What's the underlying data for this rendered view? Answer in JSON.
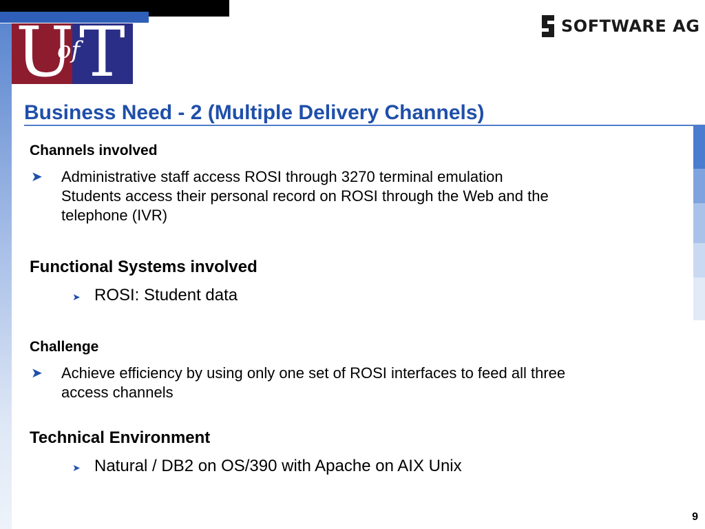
{
  "logos": {
    "uoft": {
      "u": "U",
      "of": "of",
      "t": "T"
    },
    "software_ag": {
      "text": "SOFTWARE AG"
    }
  },
  "title": "Business Need - 2 (Multiple Delivery Channels)",
  "sections": {
    "channels": {
      "heading": "Channels involved",
      "bullet_lines": [
        "Administrative staff access ROSI through 3270 terminal emulation",
        "Students access their personal record on ROSI through the Web and the",
        "telephone (IVR)"
      ]
    },
    "functional": {
      "heading": "Functional Systems involved",
      "bullet": "ROSI: Student data"
    },
    "challenge": {
      "heading": "Challenge",
      "bullet_lines": [
        "Achieve efficiency by using only one set of ROSI interfaces to feed all three",
        "access channels"
      ]
    },
    "technical": {
      "heading": "Technical Environment",
      "bullet": "Natural / DB2 on OS/390 with Apache on AIX Unix"
    }
  },
  "page_number": "9",
  "colors": {
    "title_blue": "#1f4faa",
    "uoft_red": "#8e1c2f",
    "uoft_blue": "#2a2e86"
  }
}
